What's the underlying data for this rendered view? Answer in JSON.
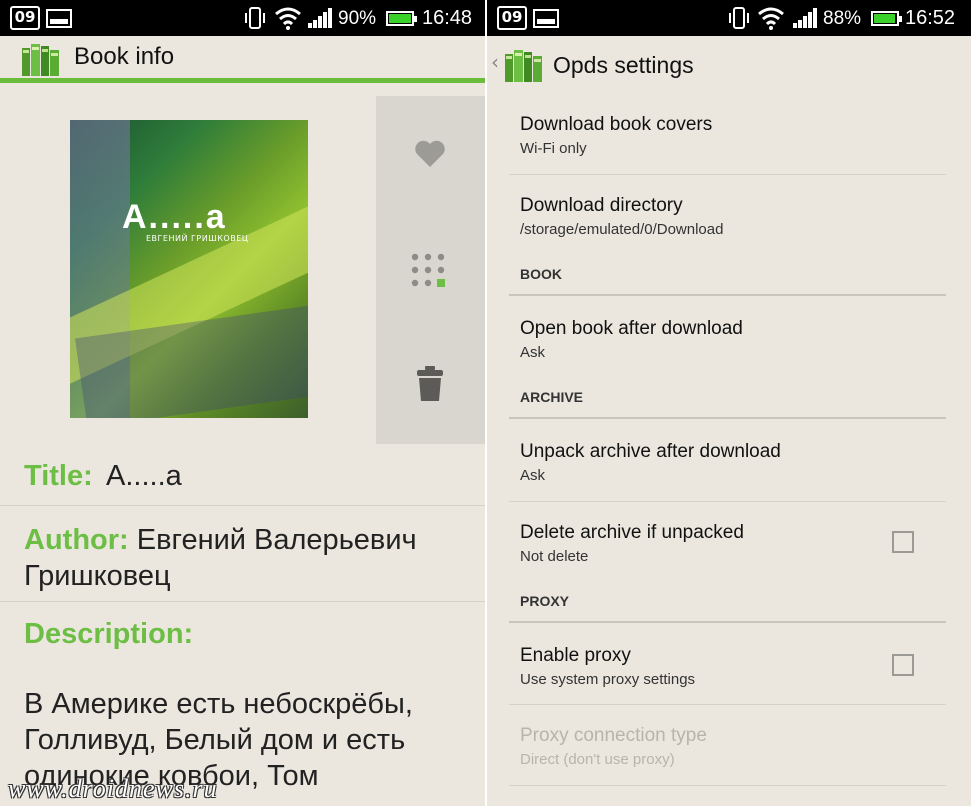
{
  "left": {
    "status": {
      "date_icon": "09",
      "battery_pct": "90%",
      "battery_level": 0.9,
      "time": "16:48"
    },
    "actionbar": {
      "title": "Book info"
    },
    "cover": {
      "title": "А.....а",
      "author": "ЕВГЕНИЙ ГРИШКОВЕЦ"
    },
    "side_actions": [
      "heart-icon",
      "grid-icon",
      "trash-icon"
    ],
    "fields": {
      "title_label": "Title:",
      "title_value": "А.....а",
      "author_label": "Author:",
      "author_value": "Евгений Валерьевич Гришковец",
      "description_label": "Description:",
      "description_text": "В Америке есть небоскрёбы, Голливуд, Белый дом и есть одинокие ковбои, Том"
    },
    "watermark": "www.droidnews.ru"
  },
  "right": {
    "status": {
      "date_icon": "09",
      "battery_pct": "88%",
      "battery_level": 0.88,
      "time": "16:52"
    },
    "actionbar": {
      "back": "‹",
      "title": "Opds settings"
    },
    "prefs": {
      "covers": {
        "title": "Download book covers",
        "summary": "Wi-Fi only"
      },
      "directory": {
        "title": "Download directory",
        "summary": "/storage/emulated/0/Download"
      },
      "section_book": "BOOK",
      "open_after": {
        "title": "Open book after download",
        "summary": "Ask"
      },
      "section_archive": "ARCHIVE",
      "unpack": {
        "title": "Unpack archive after download",
        "summary": "Ask"
      },
      "delete_archive": {
        "title": "Delete archive if unpacked",
        "summary": "Not delete",
        "checked": false
      },
      "section_proxy": "PROXY",
      "enable_proxy": {
        "title": "Enable proxy",
        "summary": "Use system proxy settings",
        "checked": false
      },
      "proxy_type": {
        "title": "Proxy connection type",
        "summary": "Direct (don't use proxy)",
        "enabled": false
      }
    }
  },
  "colors": {
    "accent_green": "#6dbe45",
    "background": "#ebe7df",
    "status_bar": "#000000",
    "battery": "#3bd12b"
  }
}
